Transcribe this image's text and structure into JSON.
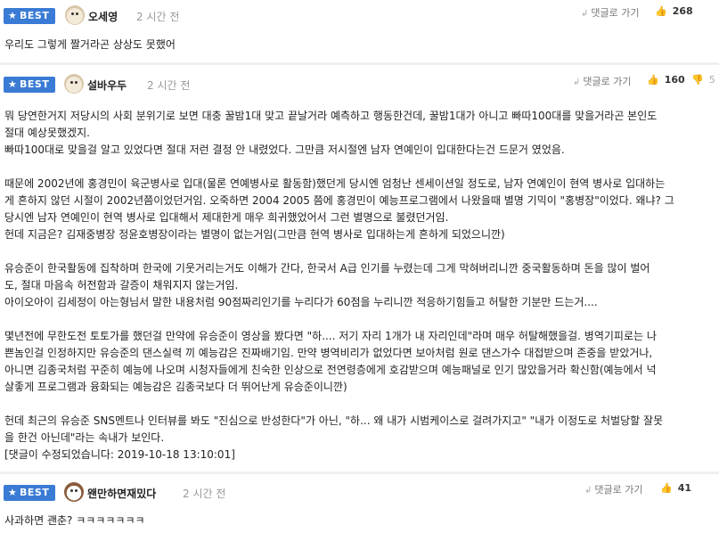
{
  "badge_label": "BEST",
  "reply_label": "댓글로 가기",
  "comments": [
    {
      "nickname": "오세영",
      "time": "2 시간 전",
      "likes": "268",
      "dislikes": "",
      "lines": [
        "우리도 그렇게 짤거라곤 상상도 못했어"
      ]
    },
    {
      "nickname": "설바우두",
      "time": "2 시간 전",
      "likes": "160",
      "dislikes": "5",
      "lines": [
        "뭐 당연한거지 저당시의 사회 분위기로 보면 대충 꿀밤1대 맞고 끝날거라 예측하고 행동한건데, 꿀밤1대가 아니고 빠따100대를 맞을거라곤 본인도",
        "절대 예상못했겠지.",
        "빠따100대로 맞을걸 알고 있었다면 절대 저런 결정 안 내렸었다. 그만큼 저시절엔 남자 연예인이 입대한다는건 드문거 였었음.",
        "",
        "때문에 2002년에 홍경민이 육군병사로 입대(물론 연예병사로 활동함)했던게 당시엔 엄청난 센세이션일 정도로, 남자 연예인이 현역 병사로 입대하는",
        "게 흔하지 않던 시절이 2002년쯤이었던거임. 오죽하면 2004 2005 쯤에 홍경민이 예능프로그램에서 나왔을때 별명 기믹이 \"홍병장\"이었다. 왜냐? 그",
        "당시엔 남자 연예인이 현역 병사로 입대해서 제대한게 매우 희귀했었어서 그런 별명으로 불렸던거임.",
        "헌데 지금은? 김재중병장 정윤호병장이라는 별명이 없는거임(그만큼 현역 병사로 입대하는게 흔하게 되었으니깐)",
        "",
        "유승준이 한국활동에 집착하며 한국에 기웃거리는거도 이해가 간다, 한국서 A급 인기를 누렸는데 그게 막혀버리니깐 중국활동하며 돈을 많이 벌어",
        "도, 절대 마음속 허전함과 갈증이 채워지지 않는거임.",
        "아이오아이 김세정이 아는형님서 말한 내용처럼 90점짜리인기를 누리다가 60점을 누리니깐 적응하기힘들고 허탈한 기분만 드는거....",
        "",
        "몇년전에 무한도전 토토가를 했던걸 만약에 유승준이 영상을 봤다면 \"하.... 저기 자리 1개가 내 자리인데\"라며 매우 허탈해했을걸. 병역기피로는 나",
        "쁜놈인걸 인정하지만 유승준의 댄스실력 끼 예능감은 진짜배기임. 만약 병역비리가 없었다면 보아처럼 원로 댄스가수 대접받으며 존중을 받았거나,",
        "아니면 김종국처럼 꾸준히 예능에 나오며 시청자들에게 친숙한 인상으로 전연령층에게 호감받으며 예능패널로 인기 많았을거라 확신함(예능에서 넉",
        "살좋게 프로그램과 융화되는 예능감은 김종국보다 더 뛰어난게 유승준이니깐)",
        "",
        "헌데 최근의 유승준 SNS멘트나 인터뷰를 봐도 \"진심으로 반성한다\"가 아닌, \"하... 왜 내가 시범케이스로 걸려가지고\" \"내가 이정도로 처벌당할 잘못",
        "을 한건 아닌데\"라는 속내가 보인다.",
        "[댓글이 수정되었습니다: 2019-10-18 13:10:01]"
      ]
    },
    {
      "nickname": "왠만하면재밌다",
      "time": "2 시간 전",
      "likes": "41",
      "dislikes": "",
      "lines": [
        "사과하면 괜춘? ㅋㅋㅋㅋㅋㅋㅋ"
      ]
    }
  ]
}
